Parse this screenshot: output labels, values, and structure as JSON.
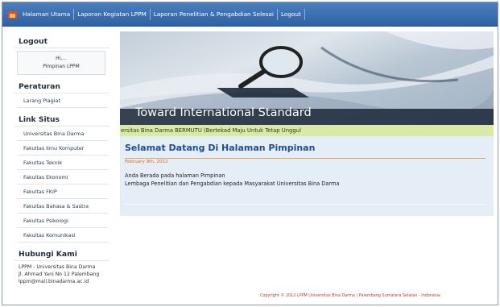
{
  "nav": {
    "items": [
      {
        "label": "Halaman Utama"
      },
      {
        "label": "Laporan Kegiatan LPPM"
      },
      {
        "label": "Laporan Penelitian & Pengabdian Selesai"
      },
      {
        "label": "Logout"
      }
    ]
  },
  "sidebar": {
    "logout_heading": "Logout",
    "greeting": "Hi,...",
    "role": "Pimpinan LPPM",
    "peraturan_heading": "Peraturan",
    "peraturan_items": [
      {
        "label": "Larang Plagiat"
      }
    ],
    "link_heading": "Link Situs",
    "links": [
      {
        "label": "Universitas Bina Darma"
      },
      {
        "label": "Fakultas Ilmu Komputer"
      },
      {
        "label": "Fakultas Teknik"
      },
      {
        "label": "Fakultas Ekonomi"
      },
      {
        "label": "Fakultas FKIP"
      },
      {
        "label": "Fakultas Bahasa & Sastra"
      },
      {
        "label": "Fakultas Psikologi"
      },
      {
        "label": "Fakultas Komunikasi"
      }
    ],
    "contact_heading": "Hubungi Kami",
    "contact_lines": [
      "LPPM - Universitas Bina Darma",
      "Jl. Ahmad Yani No 12 Palembang",
      "lppm@mail.binadarma.ac.id"
    ]
  },
  "banner": {
    "title": "Toward International Standard",
    "marquee": "ersitas Bina Darma BERMUTU (Bertekad Maju Untuk Tetap Unggul"
  },
  "content": {
    "title": "Selamat Datang Di Halaman Pimpinan",
    "date": "February 9th, 2012",
    "line1": "Anda Berada pada halaman Pimpinan",
    "line2": "Lembaga Penelitian dan Pengabdian kepada Masyarakat Universitas Bina Darma"
  },
  "footer": {
    "copyright": "Copyright © 2012 LPPM Universitas Bina Darma | Palembang Sumatera Selatan - Indonesia"
  },
  "colors": {
    "nav_bg": "#3a6fb0",
    "heading_blue": "#1d4f8c",
    "accent_orange": "#d2691e",
    "marquee_bg": "#d9eaa6",
    "footer_red": "#c0392b"
  },
  "icons": {
    "home": "home-icon",
    "magnifier": "magnifier-icon"
  }
}
